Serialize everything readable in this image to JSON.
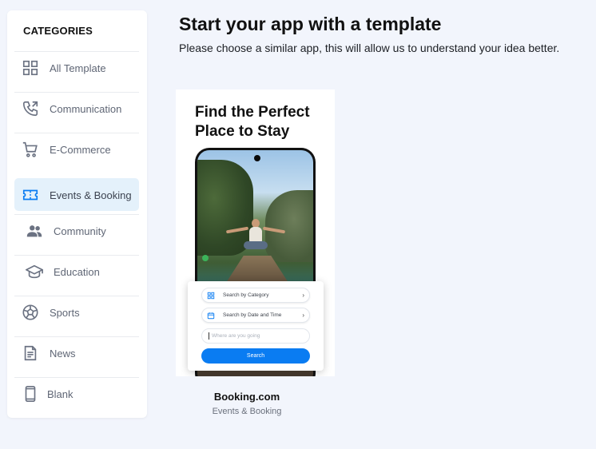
{
  "sidebar": {
    "title": "CATEGORIES",
    "items": [
      {
        "label": "All Template",
        "icon": "grid-icon",
        "active": false
      },
      {
        "label": "Communication",
        "icon": "phone-forward-icon",
        "active": false
      },
      {
        "label": "E-Commerce",
        "icon": "cart-icon",
        "active": false
      },
      {
        "label": "Events & Booking",
        "icon": "ticket-icon",
        "active": true
      },
      {
        "label": "Community",
        "icon": "people-icon",
        "active": false
      },
      {
        "label": "Education",
        "icon": "graduation-cap-icon",
        "active": false
      },
      {
        "label": "Sports",
        "icon": "soccer-ball-icon",
        "active": false
      },
      {
        "label": "News",
        "icon": "article-icon",
        "active": false
      },
      {
        "label": "Blank",
        "icon": "mobile-device-icon",
        "active": false
      }
    ]
  },
  "header": {
    "title": "Start your app with a template",
    "subtitle": "Please choose a similar app, this will allow us to understand your idea better."
  },
  "template": {
    "name": "Booking.com",
    "category": "Events & Booking",
    "preview": {
      "heading": "Find the Perfect Place to Stay",
      "search_by_category": "Search by Category",
      "search_by_date": "Search by Date and Time",
      "where_placeholder": "Where are you going",
      "search_button": "Search"
    }
  },
  "colors": {
    "accent": "#0a7cf2",
    "active_bg": "#e4f1fb",
    "page_bg": "#f2f5fc",
    "icon": "#6b7282"
  }
}
